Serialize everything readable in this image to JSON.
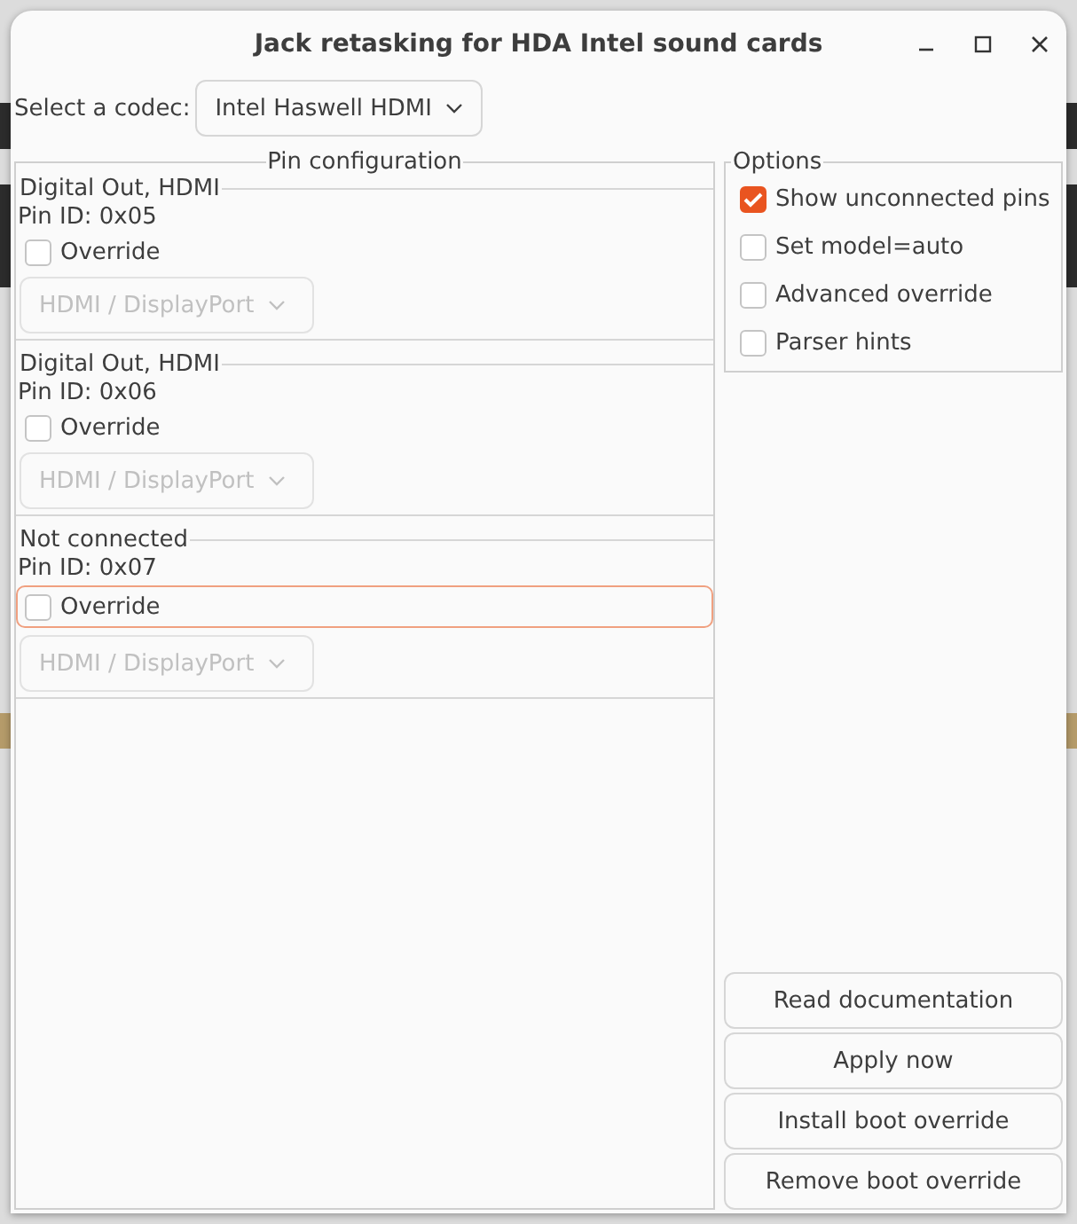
{
  "window": {
    "title": "Jack retasking for HDA Intel sound cards"
  },
  "codec": {
    "label": "Select a codec:",
    "value": "Intel Haswell HDMI"
  },
  "pin_configuration": {
    "title": "Pin configuration",
    "pins": [
      {
        "name": "Digital Out, HDMI",
        "pin_id": "Pin ID: 0x05",
        "override": {
          "label": "Override",
          "checked": false,
          "focused": false
        },
        "connection": {
          "value": "HDMI / DisplayPort",
          "disabled": true
        }
      },
      {
        "name": "Digital Out, HDMI",
        "pin_id": "Pin ID: 0x06",
        "override": {
          "label": "Override",
          "checked": false,
          "focused": false
        },
        "connection": {
          "value": "HDMI / DisplayPort",
          "disabled": true
        }
      },
      {
        "name": "Not connected",
        "pin_id": "Pin ID: 0x07",
        "override": {
          "label": "Override",
          "checked": false,
          "focused": true
        },
        "connection": {
          "value": "HDMI / DisplayPort",
          "disabled": true
        }
      }
    ]
  },
  "options": {
    "title": "Options",
    "items": [
      {
        "label": "Show unconnected pins",
        "checked": true
      },
      {
        "label": "Set model=auto",
        "checked": false
      },
      {
        "label": "Advanced override",
        "checked": false
      },
      {
        "label": "Parser hints",
        "checked": false
      }
    ]
  },
  "buttons": [
    "Read documentation",
    "Apply now",
    "Install boot override",
    "Remove boot override"
  ]
}
